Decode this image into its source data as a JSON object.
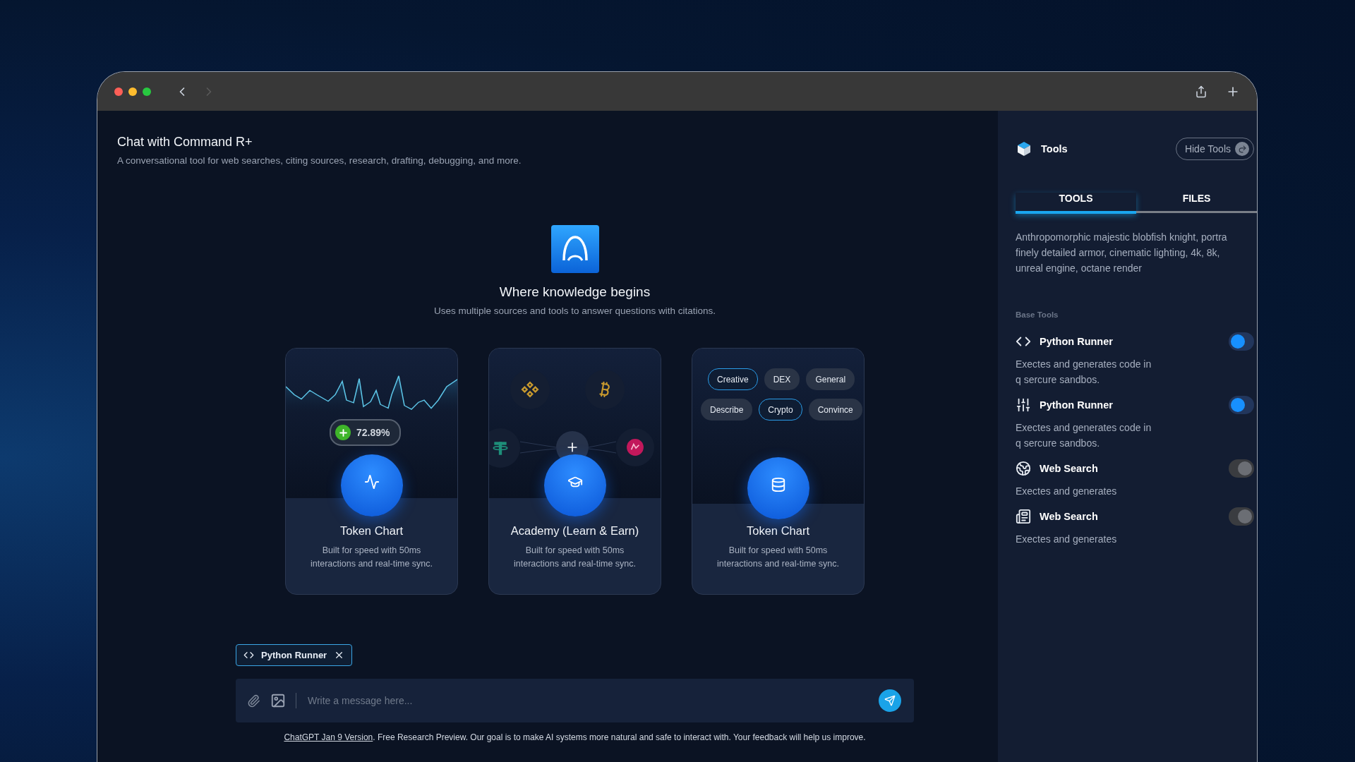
{
  "header": {
    "title": "Chat with Command R+",
    "subtitle": "A conversational tool for web searches, citing sources, research, drafting, debugging, and more."
  },
  "hero": {
    "title": "Where knowledge begins",
    "subtitle": "Uses multiple sources and tools to answer questions with citations."
  },
  "cards": [
    {
      "kind": "chart",
      "title": "Token Chart",
      "description": "Built for speed with 50ms interactions and real-time sync.",
      "badge": "72.89%"
    },
    {
      "kind": "coins",
      "title": "Academy (Learn & Earn)",
      "description": "Built for speed with 50ms interactions and real-time sync."
    },
    {
      "kind": "tags",
      "title": "Token Chart",
      "description": "Built for speed with 50ms interactions and real-time sync.",
      "tags": [
        [
          {
            "label": "Creative",
            "selected": true
          },
          {
            "label": "DEX",
            "selected": false
          },
          {
            "label": "General",
            "selected": false
          }
        ],
        [
          {
            "label": "Describe",
            "selected": false
          },
          {
            "label": "Crypto",
            "selected": true
          },
          {
            "label": "Convince",
            "selected": false
          }
        ]
      ]
    }
  ],
  "composer": {
    "attachment": "Python Runner",
    "placeholder": "Write a message here..."
  },
  "footer": {
    "link": "ChatGPT Jan 9 Version",
    "text": ". Free Research Preview. Our goal is to make AI systems more natural and safe to interact with. Your feedback will help us improve."
  },
  "sidebar": {
    "title": "Tools",
    "hide_button": "Hide Tools",
    "tabs": [
      {
        "label": "TOOLS",
        "selected": true
      },
      {
        "label": "FILES",
        "selected": false
      }
    ],
    "description_lines": [
      "Anthropomorphic majestic blobfish knight, portra",
      "finely detailed armor, cinematic lighting,  4k, 8k,",
      "unreal engine, octane render"
    ],
    "section_label": "Base Tools",
    "tools": [
      {
        "name": "Python Runner",
        "description_lines": [
          "Exectes and generates code in",
          "q sercure sandbos."
        ],
        "on": true
      },
      {
        "name": "Python Runner",
        "description_lines": [
          "Exectes and generates code in",
          "q sercure sandbos."
        ],
        "on": true
      },
      {
        "name": "Web Search",
        "description_lines": [
          "Exectes and generates"
        ],
        "on": false
      },
      {
        "name": "Web Search",
        "description_lines": [
          "Exectes and generates"
        ],
        "on": false
      }
    ]
  }
}
